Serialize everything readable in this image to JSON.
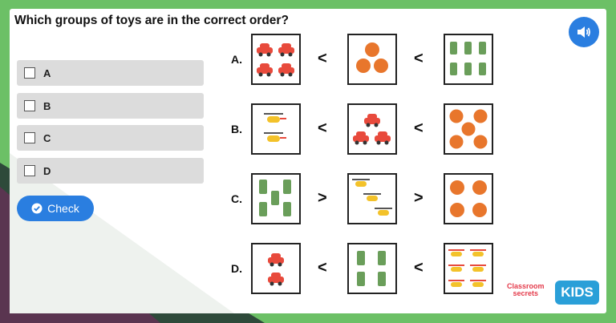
{
  "question": "Which groups of toys are in the correct order?",
  "options": [
    "A",
    "B",
    "C",
    "D"
  ],
  "check_label": "Check",
  "rows": [
    {
      "label": "A.",
      "sym1": "<",
      "sym2": "<"
    },
    {
      "label": "B.",
      "sym1": "<",
      "sym2": "<"
    },
    {
      "label": "C.",
      "sym1": ">",
      "sym2": ">"
    },
    {
      "label": "D.",
      "sym1": "<",
      "sym2": "<"
    }
  ],
  "brand": {
    "line1": "Classroom",
    "line2": "secrets",
    "kids": "KIDS"
  },
  "colors": {
    "accent": "#2a7ee0",
    "bg_green": "#6cc066"
  }
}
